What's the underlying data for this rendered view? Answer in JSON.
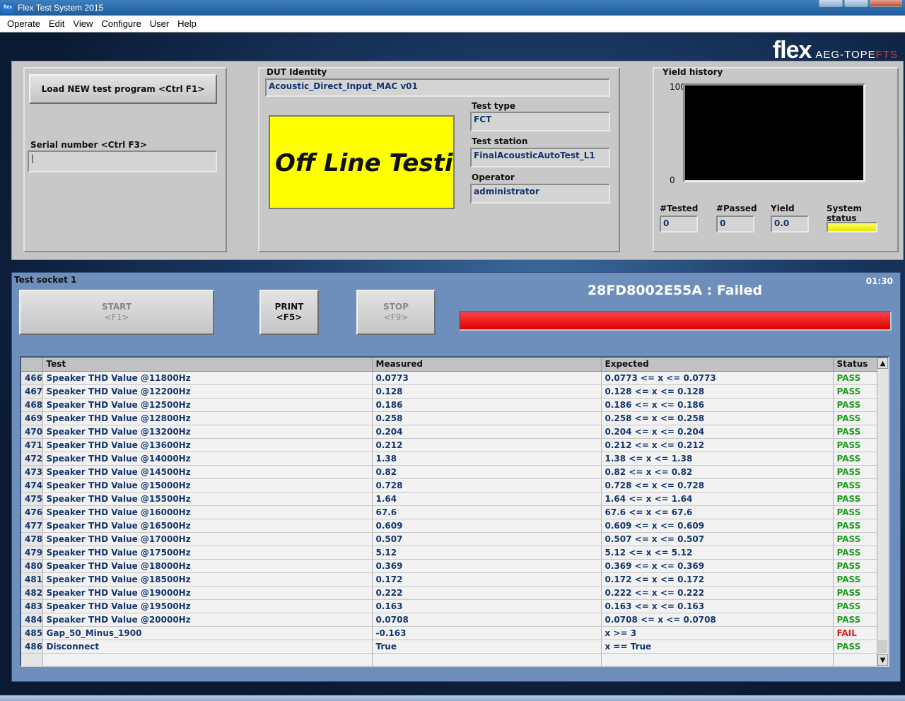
{
  "window": {
    "title": "Flex Test System 2015",
    "app_icon": "flex"
  },
  "menu": [
    "Operate",
    "Edit",
    "View",
    "Configure",
    "User",
    "Help"
  ],
  "logo": {
    "brand": "flex",
    "sub": "AEG-TOPE",
    "sub_accent": "FTS"
  },
  "top": {
    "load_button": "Load NEW test program <Ctrl F1>",
    "serial_label": "Serial number <Ctrl F3>",
    "serial_value": "|",
    "dut_label": "DUT Identity",
    "dut_value": "Acoustic_Direct_Input_MAC v01",
    "banner": "Off Line Testing",
    "test_type_label": "Test type",
    "test_type_value": "FCT",
    "test_station_label": "Test station",
    "test_station_value": "FinalAcousticAutoTest_L1",
    "operator_label": "Operator",
    "operator_value": "administrator",
    "yield_label": "Yield history",
    "yield_max": "100",
    "yield_min": "0",
    "tested_label": "#Tested",
    "tested_value": "0",
    "passed_label": "#Passed",
    "passed_value": "0",
    "yield_stat_label": "Yield",
    "yield_stat_value": "0.0",
    "system_status_label": "System status"
  },
  "socket": {
    "title": "Test socket 1",
    "time": "01:30",
    "start": "START",
    "start_key": "<F1>",
    "print": "PRINT",
    "print_key": "<F5>",
    "stop": "STOP",
    "stop_key": "<F9>",
    "result": "28FD8002E55A : Failed",
    "progress": 1.0
  },
  "table": {
    "headers": [
      "",
      "Test",
      "Measured",
      "Expected",
      "Status"
    ],
    "rows": [
      [
        "466",
        "Speaker THD Value @11800Hz",
        "0.0773",
        "0.0773 <= x <= 0.0773",
        "PASS"
      ],
      [
        "467",
        "Speaker THD Value @12200Hz",
        "0.128",
        "0.128 <= x <= 0.128",
        "PASS"
      ],
      [
        "468",
        "Speaker THD Value @12500Hz",
        "0.186",
        "0.186 <= x <= 0.186",
        "PASS"
      ],
      [
        "469",
        "Speaker THD Value @12800Hz",
        "0.258",
        "0.258 <= x <= 0.258",
        "PASS"
      ],
      [
        "470",
        "Speaker THD Value @13200Hz",
        "0.204",
        "0.204 <= x <= 0.204",
        "PASS"
      ],
      [
        "471",
        "Speaker THD Value @13600Hz",
        "0.212",
        "0.212 <= x <= 0.212",
        "PASS"
      ],
      [
        "472",
        "Speaker THD Value @14000Hz",
        "1.38",
        "1.38 <= x <= 1.38",
        "PASS"
      ],
      [
        "473",
        "Speaker THD Value @14500Hz",
        "0.82",
        "0.82 <= x <= 0.82",
        "PASS"
      ],
      [
        "474",
        "Speaker THD Value @15000Hz",
        "0.728",
        "0.728 <= x <= 0.728",
        "PASS"
      ],
      [
        "475",
        "Speaker THD Value @15500Hz",
        "1.64",
        "1.64 <= x <= 1.64",
        "PASS"
      ],
      [
        "476",
        "Speaker THD Value @16000Hz",
        "67.6",
        "67.6 <= x <= 67.6",
        "PASS"
      ],
      [
        "477",
        "Speaker THD Value @16500Hz",
        "0.609",
        "0.609 <= x <= 0.609",
        "PASS"
      ],
      [
        "478",
        "Speaker THD Value @17000Hz",
        "0.507",
        "0.507 <= x <= 0.507",
        "PASS"
      ],
      [
        "479",
        "Speaker THD Value @17500Hz",
        "5.12",
        "5.12 <= x <= 5.12",
        "PASS"
      ],
      [
        "480",
        "Speaker THD Value @18000Hz",
        "0.369",
        "0.369 <= x <= 0.369",
        "PASS"
      ],
      [
        "481",
        "Speaker THD Value @18500Hz",
        "0.172",
        "0.172 <= x <= 0.172",
        "PASS"
      ],
      [
        "482",
        "Speaker THD Value @19000Hz",
        "0.222",
        "0.222 <= x <= 0.222",
        "PASS"
      ],
      [
        "483",
        "Speaker THD Value @19500Hz",
        "0.163",
        "0.163 <= x <= 0.163",
        "PASS"
      ],
      [
        "484",
        "Speaker THD Value @20000Hz",
        "0.0708",
        "0.0708 <= x <= 0.0708",
        "PASS"
      ],
      [
        "485",
        "Gap_50_Minus_1900",
        "-0.163",
        "x >= 3",
        "FAIL"
      ],
      [
        "486",
        "Disconnect",
        "True",
        "x == True",
        "PASS"
      ]
    ]
  },
  "colors": {
    "pass": "#1f9e1f",
    "fail": "#e31a1a",
    "progress": "#dd0000",
    "banner": "#ffff00"
  }
}
